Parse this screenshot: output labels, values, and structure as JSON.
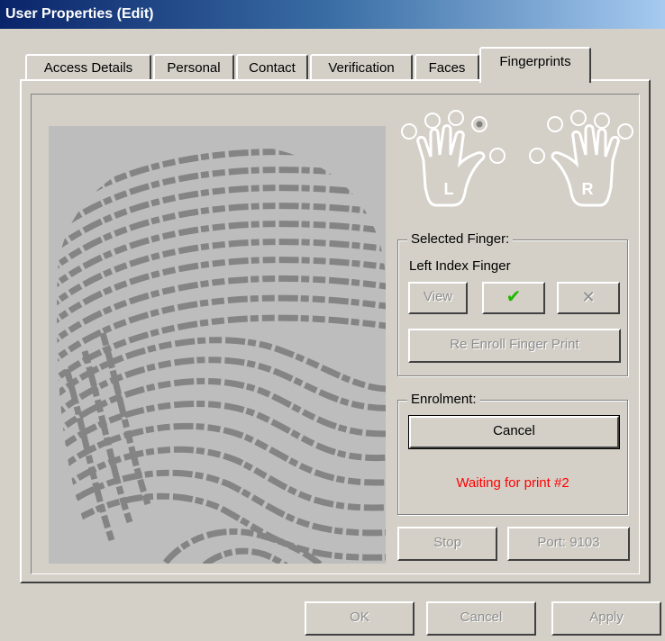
{
  "window": {
    "title": "User Properties (Edit)"
  },
  "tabs": [
    {
      "label": "Access Details"
    },
    {
      "label": "Personal"
    },
    {
      "label": "Contact"
    },
    {
      "label": "Verification"
    },
    {
      "label": "Faces"
    },
    {
      "label": "Fingerprints"
    }
  ],
  "hands": {
    "left_label": "L",
    "right_label": "R"
  },
  "selected_finger": {
    "legend": "Selected Finger:",
    "name": "Left Index Finger",
    "view_label": "View",
    "accept_symbol": "✔",
    "reject_symbol": "✕",
    "reenroll_label": "Re Enroll Finger Print"
  },
  "enrolment": {
    "legend": "Enrolment:",
    "cancel_label": "Cancel",
    "status": "Waiting for print #2"
  },
  "actions": {
    "stop_label": "Stop",
    "port_label": "Port: 9103"
  },
  "footer": {
    "ok_label": "OK",
    "cancel_label": "Cancel",
    "apply_label": "Apply"
  },
  "colors": {
    "status_red": "#ff0000",
    "check_green": "#1fb800",
    "title_blue": "#0a246a"
  }
}
